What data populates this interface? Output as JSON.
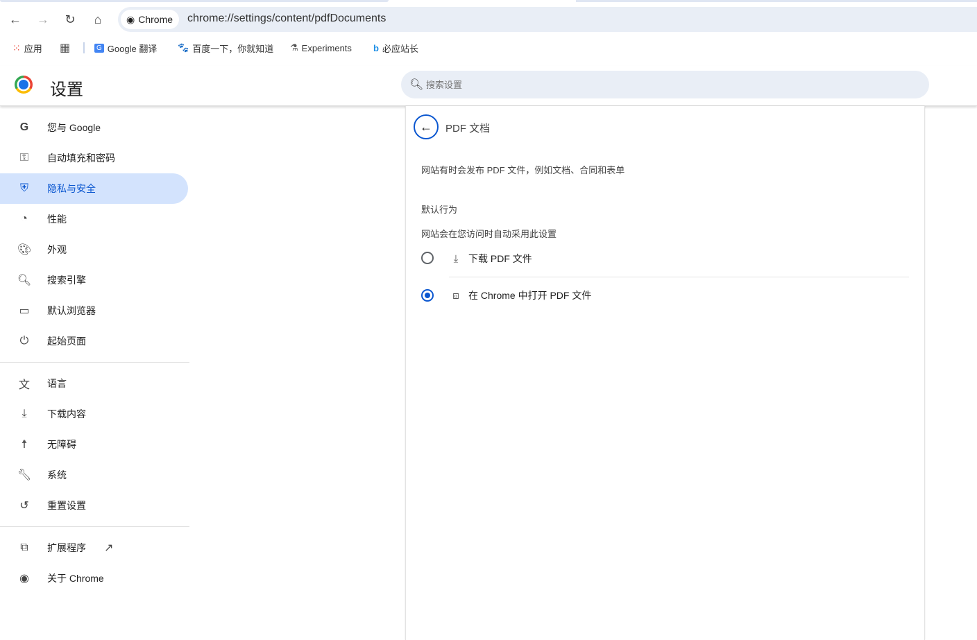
{
  "browser": {
    "chip_label": "Chrome",
    "url": "chrome://settings/content/pdfDocuments"
  },
  "bookmarks": [
    {
      "label": "应用",
      "icon": "apps-grid-icon"
    },
    {
      "label": "",
      "icon": "tab-groups-icon"
    },
    {
      "label": "Google 翻译",
      "icon": "google-translate-icon"
    },
    {
      "label": "百度一下，你就知道",
      "icon": "baidu-icon"
    },
    {
      "label": "Experiments",
      "icon": "flask-icon"
    },
    {
      "label": "必应站长",
      "icon": "bing-icon"
    }
  ],
  "header": {
    "title": "设置",
    "search_placeholder": "搜索设置"
  },
  "sidebar": {
    "items": [
      {
        "label": "您与 Google",
        "icon": "google-icon"
      },
      {
        "label": "自动填充和密码",
        "icon": "key-icon"
      },
      {
        "label": "隐私与安全",
        "icon": "shield-icon",
        "selected": true
      },
      {
        "label": "性能",
        "icon": "speedometer-icon"
      },
      {
        "label": "外观",
        "icon": "palette-icon"
      },
      {
        "label": "搜索引擎",
        "icon": "search-icon"
      },
      {
        "label": "默认浏览器",
        "icon": "browser-window-icon"
      },
      {
        "label": "起始页面",
        "icon": "power-icon"
      },
      {
        "label": "语言",
        "icon": "translate-icon"
      },
      {
        "label": "下载内容",
        "icon": "download-icon"
      },
      {
        "label": "无障碍",
        "icon": "accessibility-icon"
      },
      {
        "label": "系统",
        "icon": "wrench-icon"
      },
      {
        "label": "重置设置",
        "icon": "reset-icon"
      },
      {
        "label": "扩展程序",
        "icon": "puzzle-icon"
      },
      {
        "label": "关于 Chrome",
        "icon": "chrome-icon"
      }
    ]
  },
  "content": {
    "title": "PDF 文档",
    "description": "网站有时会发布 PDF 文件，例如文档、合同和表单",
    "default_behavior": "默认行为",
    "default_hint": "网站会在您访问时自动采用此设置",
    "options": [
      {
        "label": "下载 PDF 文件",
        "icon": "download-icon",
        "selected": false
      },
      {
        "label": "在 Chrome 中打开 PDF 文件",
        "icon": "open-in-browser-icon",
        "selected": true
      }
    ]
  },
  "colors": {
    "accent": "#0b57d0",
    "selected_bg": "#d3e3fd",
    "omnibox_bg": "#e9eef6"
  }
}
